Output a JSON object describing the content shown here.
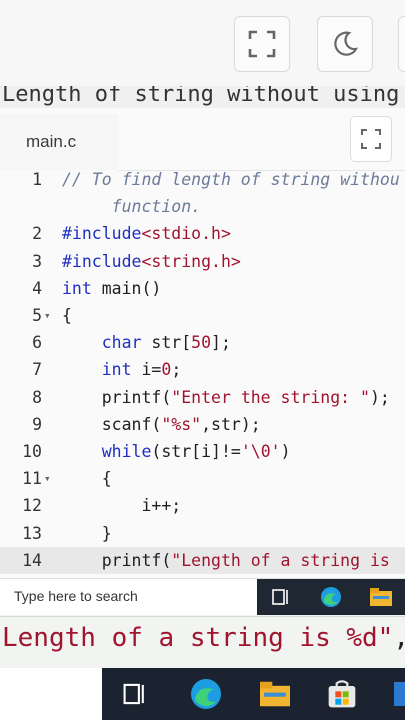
{
  "header": {
    "strip_text": "Length of string without using"
  },
  "editor": {
    "tab_label": "main.c",
    "lines": [
      {
        "n": "1",
        "fold": "",
        "parts": [
          {
            "c": "c-com",
            "t": "// To find length of string withou"
          }
        ]
      },
      {
        "n": "",
        "fold": "",
        "parts": [
          {
            "c": "c-com",
            "t": "     function."
          }
        ]
      },
      {
        "n": "2",
        "fold": "",
        "parts": [
          {
            "c": "c-kw",
            "t": "#include"
          },
          {
            "c": "c-str",
            "t": "<stdio.h>"
          }
        ]
      },
      {
        "n": "3",
        "fold": "",
        "parts": [
          {
            "c": "c-kw",
            "t": "#include"
          },
          {
            "c": "c-str",
            "t": "<string.h>"
          }
        ]
      },
      {
        "n": "4",
        "fold": "",
        "parts": [
          {
            "c": "c-kw",
            "t": "int"
          },
          {
            "c": "c-txt",
            "t": " main()"
          }
        ]
      },
      {
        "n": "5",
        "fold": "▾",
        "parts": [
          {
            "c": "c-txt",
            "t": "{"
          }
        ]
      },
      {
        "n": "6",
        "fold": "",
        "parts": [
          {
            "c": "c-txt",
            "t": "    "
          },
          {
            "c": "c-kw",
            "t": "char"
          },
          {
            "c": "c-txt",
            "t": " str["
          },
          {
            "c": "c-num",
            "t": "50"
          },
          {
            "c": "c-txt",
            "t": "];"
          }
        ]
      },
      {
        "n": "7",
        "fold": "",
        "parts": [
          {
            "c": "c-txt",
            "t": "    "
          },
          {
            "c": "c-kw",
            "t": "int"
          },
          {
            "c": "c-txt",
            "t": " i="
          },
          {
            "c": "c-num",
            "t": "0"
          },
          {
            "c": "c-txt",
            "t": ";"
          }
        ]
      },
      {
        "n": "8",
        "fold": "",
        "parts": [
          {
            "c": "c-txt",
            "t": "    printf("
          },
          {
            "c": "c-str",
            "t": "\"Enter the string: \""
          },
          {
            "c": "c-txt",
            "t": ");"
          }
        ]
      },
      {
        "n": "9",
        "fold": "",
        "parts": [
          {
            "c": "c-txt",
            "t": "    scanf("
          },
          {
            "c": "c-str",
            "t": "\"%s\""
          },
          {
            "c": "c-txt",
            "t": ",str);"
          }
        ]
      },
      {
        "n": "10",
        "fold": "",
        "parts": [
          {
            "c": "c-txt",
            "t": "    "
          },
          {
            "c": "c-kw",
            "t": "while"
          },
          {
            "c": "c-txt",
            "t": "(str[i]!="
          },
          {
            "c": "c-str",
            "t": "'\\0'"
          },
          {
            "c": "c-txt",
            "t": ")"
          }
        ]
      },
      {
        "n": "11",
        "fold": "▾",
        "parts": [
          {
            "c": "c-txt",
            "t": "    {"
          }
        ]
      },
      {
        "n": "12",
        "fold": "",
        "parts": [
          {
            "c": "c-txt",
            "t": "        i++;"
          }
        ]
      },
      {
        "n": "13",
        "fold": "",
        "parts": [
          {
            "c": "c-txt",
            "t": "    }"
          }
        ]
      },
      {
        "n": "14",
        "fold": "",
        "hl": true,
        "parts": [
          {
            "c": "c-txt",
            "t": "    printf("
          },
          {
            "c": "c-str",
            "t": "\"Length of a string is"
          }
        ]
      }
    ]
  },
  "taskbar": {
    "search_placeholder": "Type here to search"
  },
  "overlay": {
    "big_text_parts": [
      {
        "c": "c-str",
        "t": "Length of a string is %d\""
      },
      {
        "c": "c-txt",
        "t": ",i);"
      }
    ]
  },
  "colors": {
    "keyword": "#1f2fbf",
    "string": "#a0142e",
    "comment": "#6b7b9a",
    "taskbar": "#1b2330"
  }
}
